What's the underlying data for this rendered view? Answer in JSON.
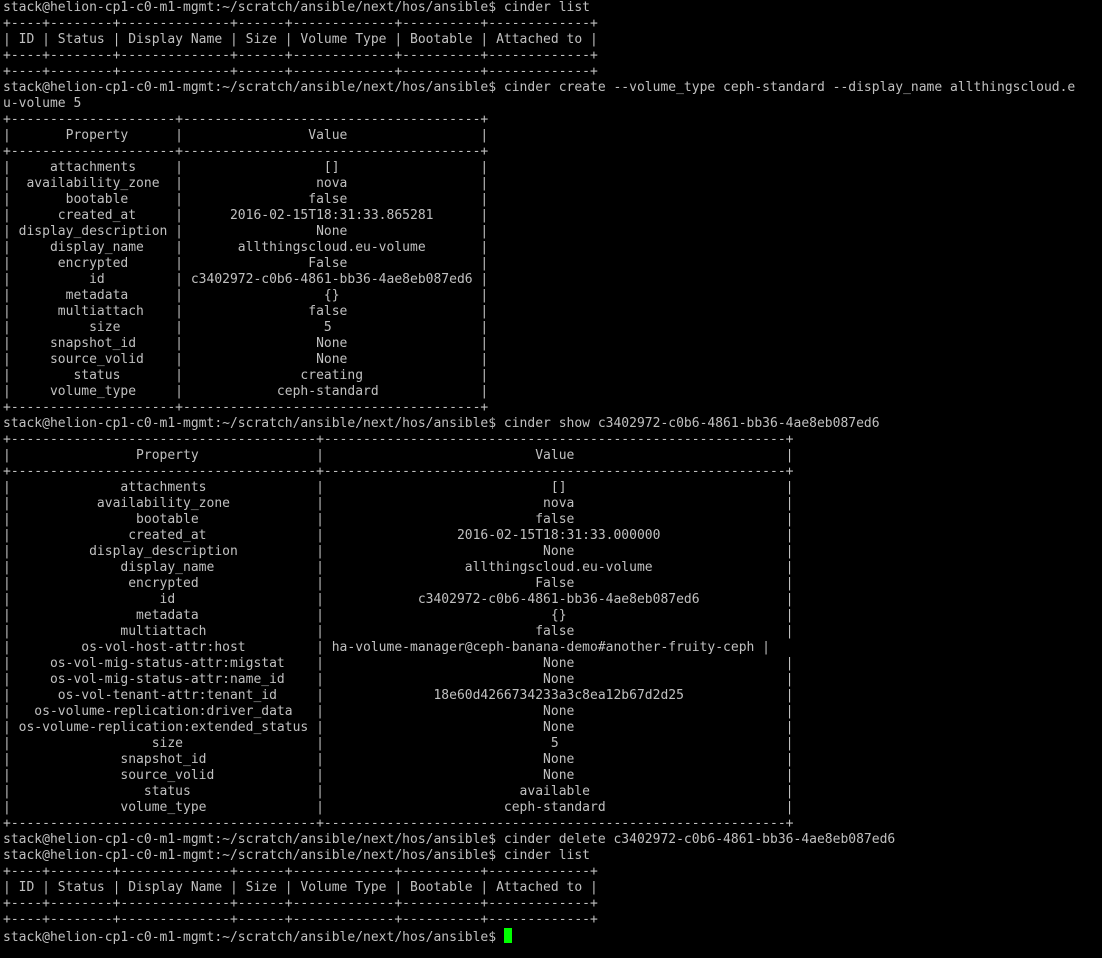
{
  "terminal": {
    "prompt": "stack@helion-cp1-c0-m1-mgmt:~/scratch/ansible/next/hos/ansible$ ",
    "cursor_color": "#00ff00",
    "text_color": "#c0c0c0",
    "background_color": "#000000",
    "lines": [
      "stack@helion-cp1-c0-m1-mgmt:~/scratch/ansible/next/hos/ansible$ cinder list",
      "+----+--------+--------------+------+-------------+----------+-------------+",
      "| ID | Status | Display Name | Size | Volume Type | Bootable | Attached to |",
      "+----+--------+--------------+------+-------------+----------+-------------+",
      "+----+--------+--------------+------+-------------+----------+-------------+",
      "stack@helion-cp1-c0-m1-mgmt:~/scratch/ansible/next/hos/ansible$ cinder create --volume_type ceph-standard --display_name allthingscloud.e",
      "u-volume 5",
      "+---------------------+--------------------------------------+",
      "|       Property      |                Value                 |",
      "+---------------------+--------------------------------------+",
      "|     attachments     |                  []                  |",
      "|  availability_zone  |                 nova                 |",
      "|       bootable      |                false                 |",
      "|      created_at     |      2016-02-15T18:31:33.865281      |",
      "| display_description |                 None                 |",
      "|     display_name    |       allthingscloud.eu-volume       |",
      "|      encrypted      |                False                 |",
      "|          id         | c3402972-c0b6-4861-bb36-4ae8eb087ed6 |",
      "|       metadata      |                  {}                  |",
      "|      multiattach    |                false                 |",
      "|          size       |                  5                   |",
      "|     snapshot_id     |                 None                 |",
      "|     source_volid    |                 None                 |",
      "|        status       |               creating               |",
      "|     volume_type     |            ceph-standard             |",
      "+---------------------+--------------------------------------+",
      "stack@helion-cp1-c0-m1-mgmt:~/scratch/ansible/next/hos/ansible$ cinder show c3402972-c0b6-4861-bb36-4ae8eb087ed6",
      "+---------------------------------------+-----------------------------------------------------------+",
      "|                Property               |                           Value                           |",
      "+---------------------------------------+-----------------------------------------------------------+",
      "|              attachments              |                             []                            |",
      "|           availability_zone           |                            nova                           |",
      "|                bootable               |                           false                           |",
      "|               created_at              |                 2016-02-15T18:31:33.000000                |",
      "|          display_description          |                            None                           |",
      "|              display_name             |                  allthingscloud.eu-volume                 |",
      "|               encrypted               |                           False                           |",
      "|                   id                  |            c3402972-c0b6-4861-bb36-4ae8eb087ed6           |",
      "|                metadata               |                             {}                            |",
      "|              multiattach              |                           false                           |",
      "|         os-vol-host-attr:host         | ha-volume-manager@ceph-banana-demo#another-fruity-ceph |",
      "|     os-vol-mig-status-attr:migstat    |                            None                           |",
      "|     os-vol-mig-status-attr:name_id    |                            None                           |",
      "|      os-vol-tenant-attr:tenant_id     |              18e60d4266734233a3c8ea12b67d2d25             |",
      "|   os-volume-replication:driver_data   |                            None                           |",
      "| os-volume-replication:extended_status |                            None                           |",
      "|                  size                 |                             5                             |",
      "|              snapshot_id              |                            None                           |",
      "|              source_volid             |                            None                           |",
      "|                 status                |                         available                         |",
      "|              volume_type              |                       ceph-standard                       |",
      "+---------------------------------------+-----------------------------------------------------------+",
      "stack@helion-cp1-c0-m1-mgmt:~/scratch/ansible/next/hos/ansible$ cinder delete c3402972-c0b6-4861-bb36-4ae8eb087ed6",
      "stack@helion-cp1-c0-m1-mgmt:~/scratch/ansible/next/hos/ansible$ cinder list",
      "+----+--------+--------------+------+-------------+----------+-------------+",
      "| ID | Status | Display Name | Size | Volume Type | Bootable | Attached to |",
      "+----+--------+--------------+------+-------------+----------+-------------+",
      "+----+--------+--------------+------+-------------+----------+-------------+"
    ]
  }
}
